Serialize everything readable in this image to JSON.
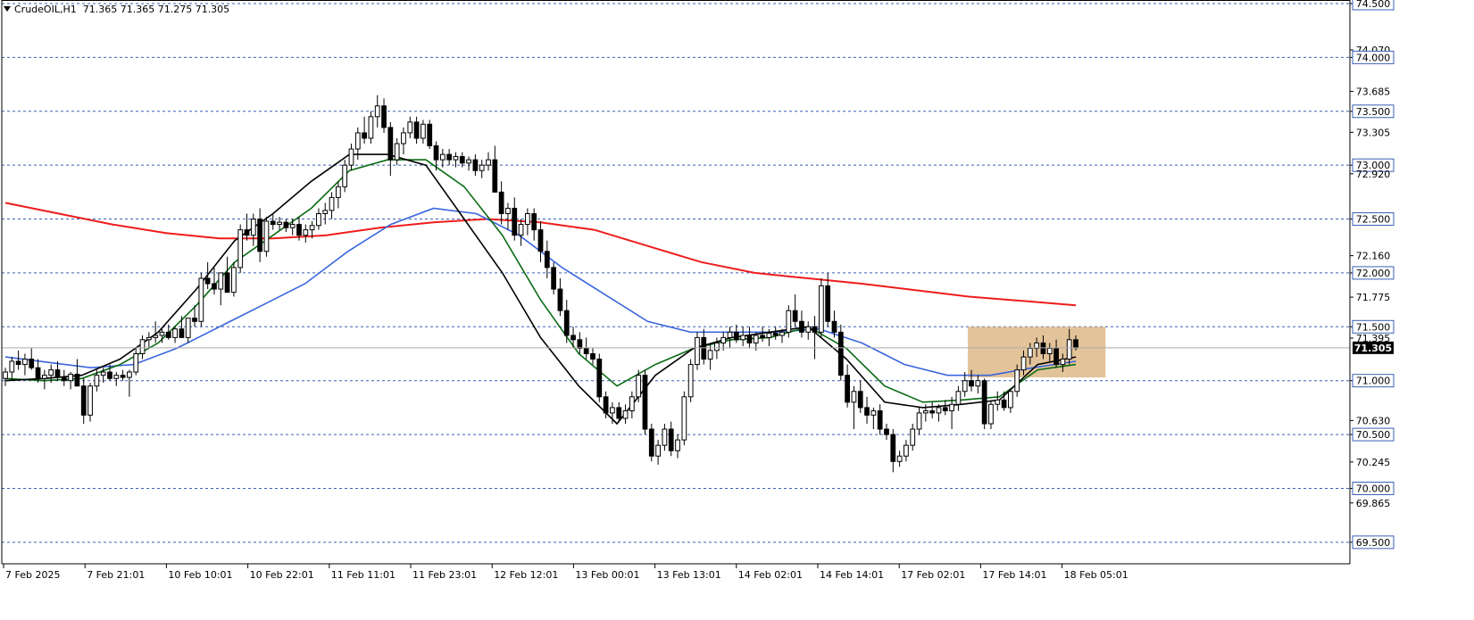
{
  "header": {
    "symbol": "CrudeOIL,H1",
    "ohlc": "71.365 71.365 71.275 71.305"
  },
  "colors": {
    "background": "#ffffff",
    "grid": "#3a5fb5",
    "candle_up": "#ffffff",
    "candle_down": "#000000",
    "ma_red": "#ee1c1c",
    "ma_blue": "#3a66dd",
    "ma_green": "#0a6b12",
    "ma_black": "#000000",
    "zone": "#deb887",
    "current_price_bg": "#000000",
    "current_price_text": "#ffffff"
  },
  "chart_data": {
    "type": "candlestick",
    "symbol": "CrudeOIL",
    "timeframe": "H1",
    "ylim": [
      69.3,
      74.5
    ],
    "grid": "horizontal dashed at 0.5 levels",
    "y_tick_labels": [
      "74.500",
      "74.070",
      "74.000",
      "73.685",
      "73.500",
      "73.305",
      "73.000",
      "72.920",
      "72.500",
      "72.160",
      "72.000",
      "71.775",
      "71.500",
      "71.395",
      "71.000",
      "70.630",
      "70.500",
      "70.245",
      "70.000",
      "69.865",
      "69.500"
    ],
    "boxed_levels": [
      74.5,
      74.0,
      73.5,
      73.0,
      72.5,
      72.0,
      71.5,
      71.0,
      70.5,
      70.0,
      69.5
    ],
    "current_price": 71.305,
    "current_price_label": "71.305",
    "x_tick_labels": [
      "7 Feb 2025",
      "7 Feb 21:01",
      "10 Feb 10:01",
      "10 Feb 22:01",
      "11 Feb 11:01",
      "11 Feb 23:01",
      "12 Feb 12:01",
      "13 Feb 00:01",
      "13 Feb 13:01",
      "14 Feb 02:01",
      "14 Feb 14:01",
      "17 Feb 02:01",
      "17 Feb 14:01",
      "18 Feb 05:01"
    ],
    "candles": [
      [
        71.02,
        71.12,
        70.95,
        71.08
      ],
      [
        71.08,
        71.22,
        71.0,
        71.18
      ],
      [
        71.18,
        71.28,
        71.1,
        71.15
      ],
      [
        71.15,
        71.25,
        71.05,
        71.2
      ],
      [
        71.2,
        71.3,
        71.1,
        71.12
      ],
      [
        71.12,
        71.2,
        70.98,
        71.02
      ],
      [
        71.02,
        71.1,
        70.92,
        71.05
      ],
      [
        71.05,
        71.15,
        70.98,
        71.1
      ],
      [
        71.1,
        71.18,
        71.0,
        71.03
      ],
      [
        71.03,
        71.1,
        70.95,
        71.0
      ],
      [
        71.0,
        71.08,
        70.92,
        71.06
      ],
      [
        71.06,
        71.2,
        71.02,
        70.95
      ],
      [
        70.95,
        71.02,
        70.6,
        70.68
      ],
      [
        70.68,
        70.98,
        70.62,
        70.95
      ],
      [
        70.95,
        71.1,
        70.9,
        71.05
      ],
      [
        71.05,
        71.12,
        70.98,
        71.08
      ],
      [
        71.08,
        71.15,
        71.0,
        71.02
      ],
      [
        71.02,
        71.08,
        70.95,
        71.05
      ],
      [
        71.05,
        71.1,
        71.0,
        71.03
      ],
      [
        71.03,
        71.1,
        70.85,
        71.08
      ],
      [
        71.08,
        71.3,
        71.05,
        71.25
      ],
      [
        71.25,
        71.42,
        71.2,
        71.38
      ],
      [
        71.38,
        71.45,
        71.3,
        71.4
      ],
      [
        71.4,
        71.55,
        71.35,
        71.42
      ],
      [
        71.42,
        71.48,
        71.35,
        71.45
      ],
      [
        71.45,
        71.52,
        71.38,
        71.4
      ],
      [
        71.4,
        71.5,
        71.35,
        71.48
      ],
      [
        71.48,
        71.6,
        71.42,
        71.4
      ],
      [
        71.4,
        71.55,
        71.35,
        71.58
      ],
      [
        71.58,
        71.7,
        71.5,
        71.55
      ],
      [
        71.55,
        72.0,
        71.5,
        71.95
      ],
      [
        71.95,
        72.1,
        71.85,
        71.9
      ],
      [
        71.9,
        72.05,
        71.8,
        71.85
      ],
      [
        71.85,
        72.0,
        71.7,
        72.0
      ],
      [
        72.0,
        72.15,
        71.9,
        71.82
      ],
      [
        71.82,
        72.1,
        71.78,
        72.05
      ],
      [
        72.05,
        72.45,
        72.0,
        72.4
      ],
      [
        72.4,
        72.55,
        72.3,
        72.35
      ],
      [
        72.35,
        72.55,
        72.25,
        72.5
      ],
      [
        72.5,
        72.6,
        72.1,
        72.2
      ],
      [
        72.2,
        72.52,
        72.15,
        72.48
      ],
      [
        72.48,
        72.55,
        72.4,
        72.45
      ],
      [
        72.45,
        72.52,
        72.4,
        72.47
      ],
      [
        72.47,
        72.5,
        72.38,
        72.42
      ],
      [
        72.42,
        72.5,
        72.35,
        72.45
      ],
      [
        72.45,
        72.52,
        72.3,
        72.35
      ],
      [
        72.35,
        72.45,
        72.28,
        72.4
      ],
      [
        72.4,
        72.48,
        72.32,
        72.44
      ],
      [
        72.44,
        72.6,
        72.4,
        72.55
      ],
      [
        72.55,
        72.65,
        72.45,
        72.58
      ],
      [
        72.58,
        72.75,
        72.5,
        72.7
      ],
      [
        72.7,
        72.85,
        72.6,
        72.8
      ],
      [
        72.8,
        73.05,
        72.75,
        73.0
      ],
      [
        73.0,
        73.2,
        72.95,
        73.15
      ],
      [
        73.15,
        73.35,
        73.05,
        73.3
      ],
      [
        73.3,
        73.45,
        73.2,
        73.25
      ],
      [
        73.25,
        73.5,
        73.2,
        73.45
      ],
      [
        73.45,
        73.65,
        73.35,
        73.55
      ],
      [
        73.55,
        73.62,
        73.3,
        73.35
      ],
      [
        73.35,
        73.4,
        72.9,
        73.05
      ],
      [
        73.05,
        73.25,
        73.0,
        73.2
      ],
      [
        73.2,
        73.35,
        73.1,
        73.3
      ],
      [
        73.3,
        73.45,
        73.25,
        73.4
      ],
      [
        73.4,
        73.45,
        73.2,
        73.25
      ],
      [
        73.25,
        73.42,
        73.2,
        73.38
      ],
      [
        73.38,
        73.42,
        73.15,
        73.18
      ],
      [
        73.18,
        73.22,
        72.95,
        73.05
      ],
      [
        73.05,
        73.15,
        72.98,
        73.1
      ],
      [
        73.1,
        73.15,
        73.0,
        73.05
      ],
      [
        73.05,
        73.12,
        72.98,
        73.08
      ],
      [
        73.08,
        73.12,
        72.98,
        73.02
      ],
      [
        73.02,
        73.08,
        72.95,
        73.05
      ],
      [
        73.05,
        73.1,
        72.9,
        72.95
      ],
      [
        72.95,
        73.05,
        72.88,
        73.0
      ],
      [
        73.0,
        73.12,
        72.95,
        73.05
      ],
      [
        73.05,
        73.18,
        72.95,
        72.75
      ],
      [
        72.75,
        72.85,
        72.45,
        72.55
      ],
      [
        72.55,
        72.65,
        72.4,
        72.6
      ],
      [
        72.6,
        72.7,
        72.3,
        72.35
      ],
      [
        72.35,
        72.5,
        72.25,
        72.45
      ],
      [
        72.45,
        72.6,
        72.35,
        72.55
      ],
      [
        72.55,
        72.6,
        72.3,
        72.4
      ],
      [
        72.4,
        72.48,
        72.1,
        72.2
      ],
      [
        72.2,
        72.3,
        71.95,
        72.05
      ],
      [
        72.05,
        72.1,
        71.8,
        71.85
      ],
      [
        71.85,
        71.95,
        71.6,
        71.65
      ],
      [
        71.65,
        71.75,
        71.35,
        71.42
      ],
      [
        71.42,
        71.5,
        71.3,
        71.38
      ],
      [
        71.38,
        71.45,
        71.25,
        71.3
      ],
      [
        71.3,
        71.4,
        71.2,
        71.25
      ],
      [
        71.25,
        71.3,
        71.15,
        71.2
      ],
      [
        71.2,
        71.25,
        70.8,
        70.85
      ],
      [
        70.85,
        70.9,
        70.65,
        70.7
      ],
      [
        70.7,
        70.8,
        70.6,
        70.75
      ],
      [
        70.75,
        70.8,
        70.62,
        70.65
      ],
      [
        70.65,
        70.78,
        70.6,
        70.72
      ],
      [
        70.72,
        70.9,
        70.65,
        70.85
      ],
      [
        70.85,
        71.1,
        70.8,
        71.05
      ],
      [
        71.05,
        71.1,
        70.5,
        70.55
      ],
      [
        70.55,
        70.6,
        70.25,
        70.3
      ],
      [
        70.3,
        70.45,
        70.22,
        70.4
      ],
      [
        70.4,
        70.6,
        70.35,
        70.55
      ],
      [
        70.55,
        70.62,
        70.3,
        70.35
      ],
      [
        70.35,
        70.5,
        70.28,
        70.45
      ],
      [
        70.45,
        70.9,
        70.4,
        70.85
      ],
      [
        70.85,
        71.2,
        70.8,
        71.15
      ],
      [
        71.15,
        71.45,
        71.1,
        71.4
      ],
      [
        71.4,
        71.48,
        71.15,
        71.2
      ],
      [
        71.2,
        71.35,
        71.1,
        71.28
      ],
      [
        71.28,
        71.4,
        71.2,
        71.35
      ],
      [
        71.35,
        71.45,
        71.28,
        71.4
      ],
      [
        71.4,
        71.5,
        71.3,
        71.45
      ],
      [
        71.45,
        71.52,
        71.35,
        71.38
      ],
      [
        71.38,
        71.5,
        71.32,
        71.42
      ],
      [
        71.42,
        71.5,
        71.3,
        71.35
      ],
      [
        71.35,
        71.45,
        71.28,
        71.42
      ],
      [
        71.42,
        71.5,
        71.36,
        71.4
      ],
      [
        71.4,
        71.48,
        71.32,
        71.44
      ],
      [
        71.44,
        71.5,
        71.38,
        71.42
      ],
      [
        71.42,
        71.48,
        71.35,
        71.45
      ],
      [
        71.45,
        71.7,
        71.4,
        71.65
      ],
      [
        71.65,
        71.8,
        71.5,
        71.55
      ],
      [
        71.55,
        71.65,
        71.4,
        71.45
      ],
      [
        71.45,
        71.55,
        71.38,
        71.5
      ],
      [
        71.5,
        71.6,
        71.2,
        71.45
      ],
      [
        71.45,
        71.95,
        71.4,
        71.88
      ],
      [
        71.88,
        72.0,
        71.5,
        71.55
      ],
      [
        71.55,
        71.65,
        71.4,
        71.45
      ],
      [
        71.45,
        71.52,
        71.0,
        71.05
      ],
      [
        71.05,
        71.15,
        70.75,
        70.8
      ],
      [
        70.8,
        70.95,
        70.55,
        70.9
      ],
      [
        70.9,
        71.0,
        70.7,
        70.75
      ],
      [
        70.75,
        70.85,
        70.6,
        70.68
      ],
      [
        70.68,
        70.75,
        70.55,
        70.72
      ],
      [
        70.72,
        70.78,
        70.5,
        70.55
      ],
      [
        70.55,
        70.6,
        70.45,
        70.5
      ],
      [
        70.5,
        70.55,
        70.15,
        70.25
      ],
      [
        70.25,
        70.35,
        70.2,
        70.3
      ],
      [
        70.3,
        70.45,
        70.25,
        70.4
      ],
      [
        70.4,
        70.6,
        70.35,
        70.55
      ],
      [
        70.55,
        70.75,
        70.5,
        70.7
      ],
      [
        70.7,
        70.78,
        70.62,
        70.72
      ],
      [
        70.72,
        70.8,
        70.65,
        70.7
      ],
      [
        70.7,
        70.78,
        70.62,
        70.75
      ],
      [
        70.75,
        70.82,
        70.68,
        70.72
      ],
      [
        70.72,
        70.85,
        70.55,
        70.78
      ],
      [
        70.78,
        70.95,
        70.72,
        70.9
      ],
      [
        70.9,
        71.08,
        70.85,
        71.0
      ],
      [
        71.0,
        71.1,
        70.9,
        70.95
      ],
      [
        70.95,
        71.05,
        70.88,
        71.0
      ],
      [
        71.0,
        71.02,
        70.55,
        70.6
      ],
      [
        70.6,
        70.82,
        70.55,
        70.78
      ],
      [
        70.78,
        70.9,
        70.72,
        70.82
      ],
      [
        70.82,
        70.9,
        70.72,
        70.75
      ],
      [
        70.75,
        70.92,
        70.7,
        70.9
      ],
      [
        70.9,
        71.15,
        70.85,
        71.1
      ],
      [
        71.1,
        71.28,
        71.05,
        71.22
      ],
      [
        71.22,
        71.35,
        71.15,
        71.3
      ],
      [
        71.3,
        71.4,
        71.22,
        71.35
      ],
      [
        71.35,
        71.42,
        71.2,
        71.25
      ],
      [
        71.25,
        71.35,
        71.18,
        71.3
      ],
      [
        71.3,
        71.38,
        71.12,
        71.15
      ],
      [
        71.15,
        71.25,
        71.08,
        71.2
      ],
      [
        71.2,
        71.48,
        71.15,
        71.38
      ],
      [
        71.38,
        71.42,
        71.28,
        71.305
      ]
    ],
    "zone": {
      "x_start_candle": 148,
      "x_end_candle": 168,
      "y_low": 71.03,
      "y_high": 71.5
    },
    "series": [
      {
        "color": "#ee1c1c",
        "values": [
          72.65,
          72.55,
          72.45,
          72.37,
          72.32,
          72.32,
          72.35,
          72.42,
          72.47,
          72.5,
          72.47,
          72.4,
          72.25,
          72.1,
          72.0,
          71.95,
          71.9,
          71.84,
          71.78,
          71.74,
          71.7
        ]
      },
      {
        "color": "#3a66dd",
        "values": [
          71.22,
          71.17,
          71.12,
          71.15,
          71.3,
          71.5,
          71.7,
          71.9,
          72.2,
          72.45,
          72.6,
          72.55,
          72.35,
          72.05,
          71.8,
          71.55,
          71.45,
          71.45,
          71.45,
          71.48,
          71.35,
          71.15,
          71.05,
          71.05,
          71.12,
          71.18
        ]
      },
      {
        "color": "#0a6b12",
        "values": [
          71.02,
          71.0,
          71.02,
          71.15,
          71.35,
          71.7,
          72.1,
          72.35,
          72.6,
          72.95,
          73.05,
          73.05,
          72.8,
          72.35,
          71.75,
          71.25,
          70.95,
          71.15,
          71.3,
          71.38,
          71.4,
          71.5,
          71.3,
          70.95,
          70.8,
          70.82,
          70.85,
          71.1,
          71.15
        ]
      },
      {
        "color": "#000000",
        "values": [
          71.0,
          71.02,
          71.05,
          71.2,
          71.45,
          71.85,
          72.3,
          72.55,
          72.85,
          73.1,
          73.1,
          73.0,
          72.5,
          72.0,
          71.4,
          70.95,
          70.6,
          71.05,
          71.3,
          71.4,
          71.45,
          71.5,
          71.2,
          70.8,
          70.75,
          70.78,
          70.82,
          71.15,
          71.22
        ]
      }
    ]
  }
}
